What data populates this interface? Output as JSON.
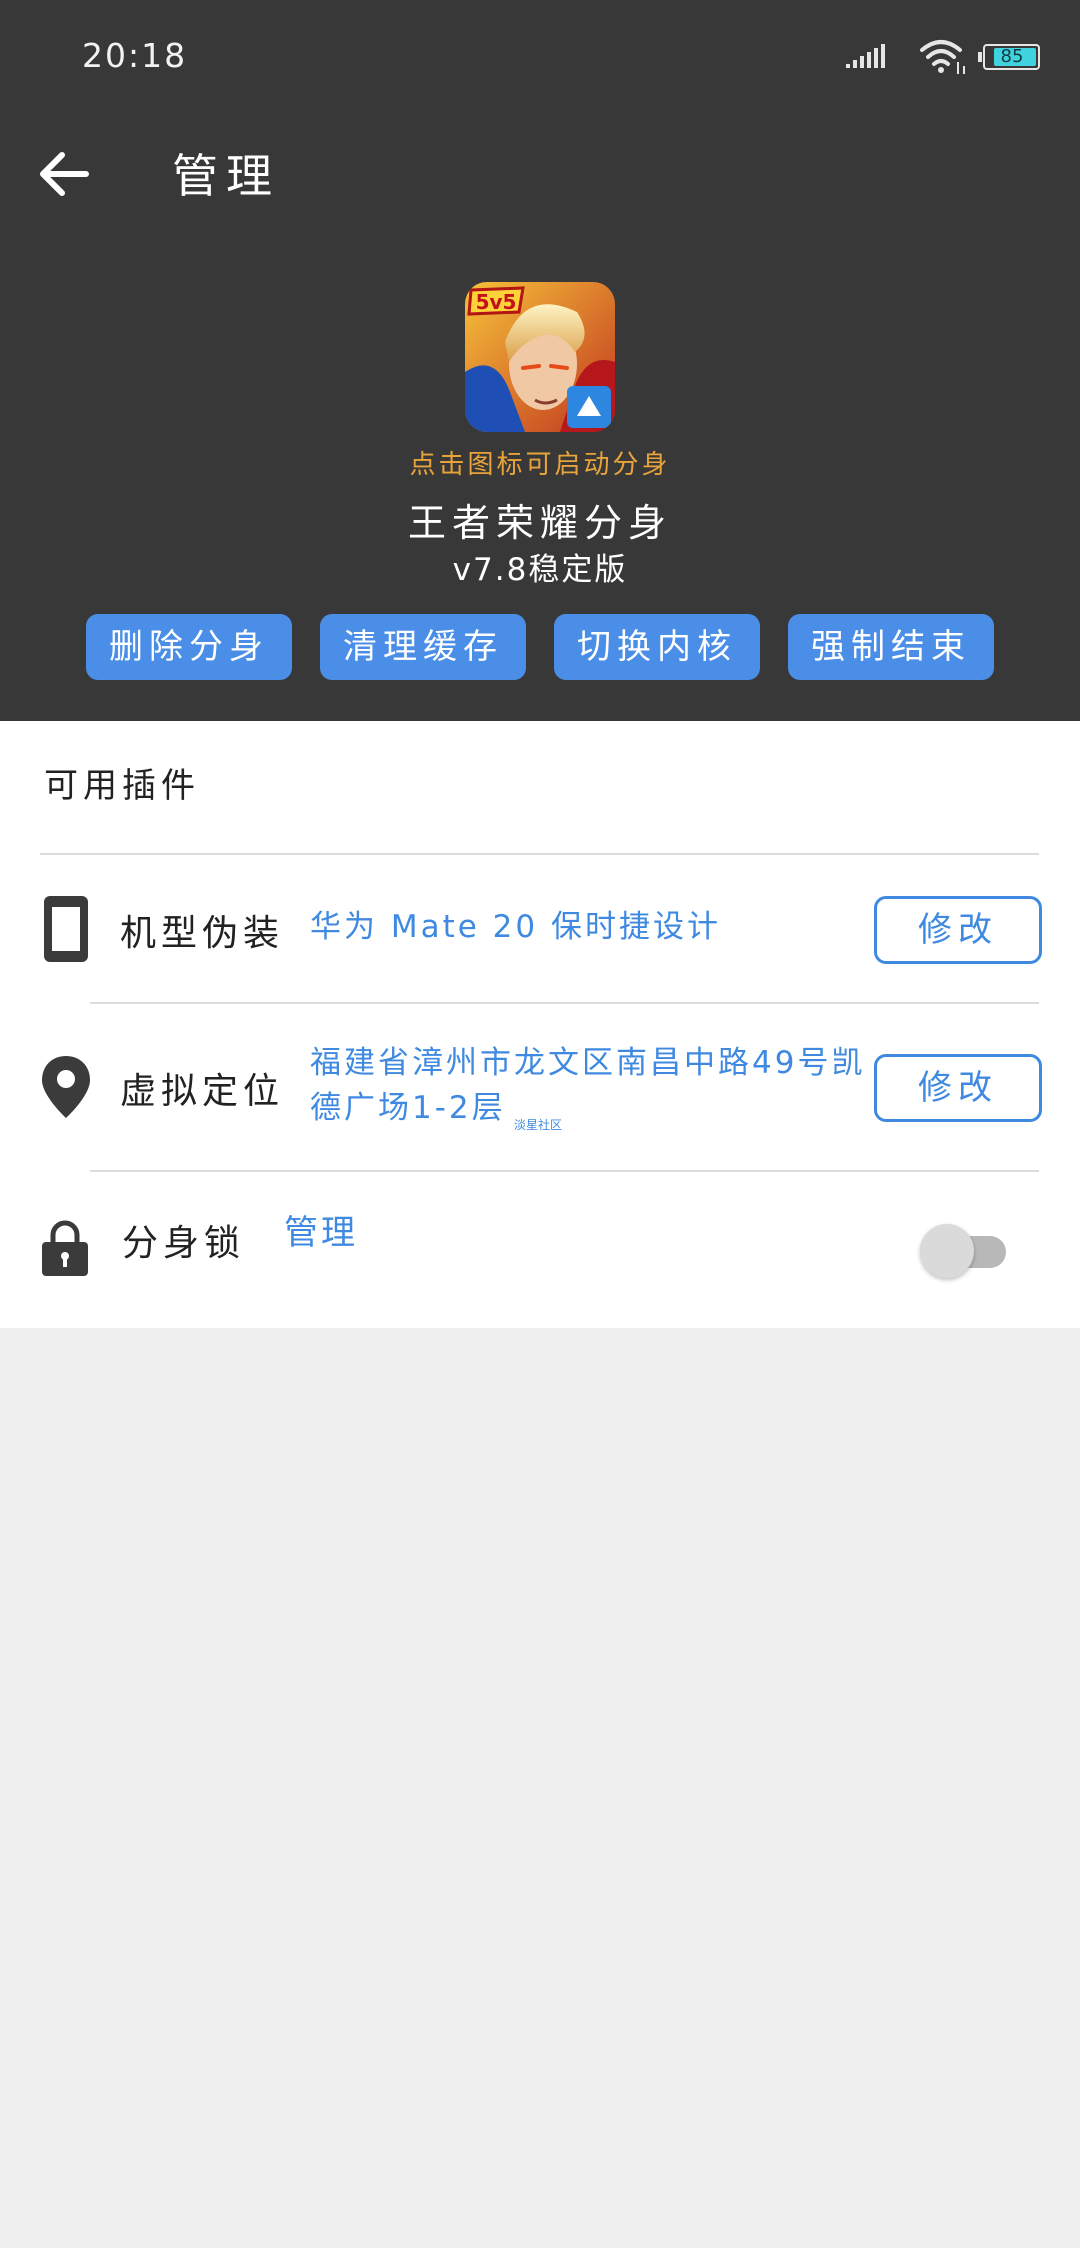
{
  "status_bar": {
    "time": "20:18",
    "battery": "85"
  },
  "header": {
    "title": "管理"
  },
  "app": {
    "hint": "点击图标可启动分身",
    "name": "王者荣耀分身",
    "version": "v7.8稳定版",
    "icon_badge": "5v5"
  },
  "actions": [
    "删除分身",
    "清理缓存",
    "切换内核",
    "强制结束"
  ],
  "plugins": {
    "title": "可用插件",
    "device_disguise": {
      "label": "机型伪装",
      "value": "华为 Mate 20 保时捷设计",
      "button": "修改"
    },
    "virtual_location": {
      "label": "虚拟定位",
      "value_line1": "福建省漳州市龙文区南昌中路49号凯",
      "value_line2": "德广场1-2层",
      "watermark": "淡星社区",
      "button": "修改"
    },
    "clone_lock": {
      "label": "分身锁",
      "link": "管理",
      "enabled": false
    }
  },
  "colors": {
    "header_bg": "#383838",
    "accent": "#4a8ee8",
    "hint": "#e8a43b",
    "link": "#3f8ae0"
  }
}
